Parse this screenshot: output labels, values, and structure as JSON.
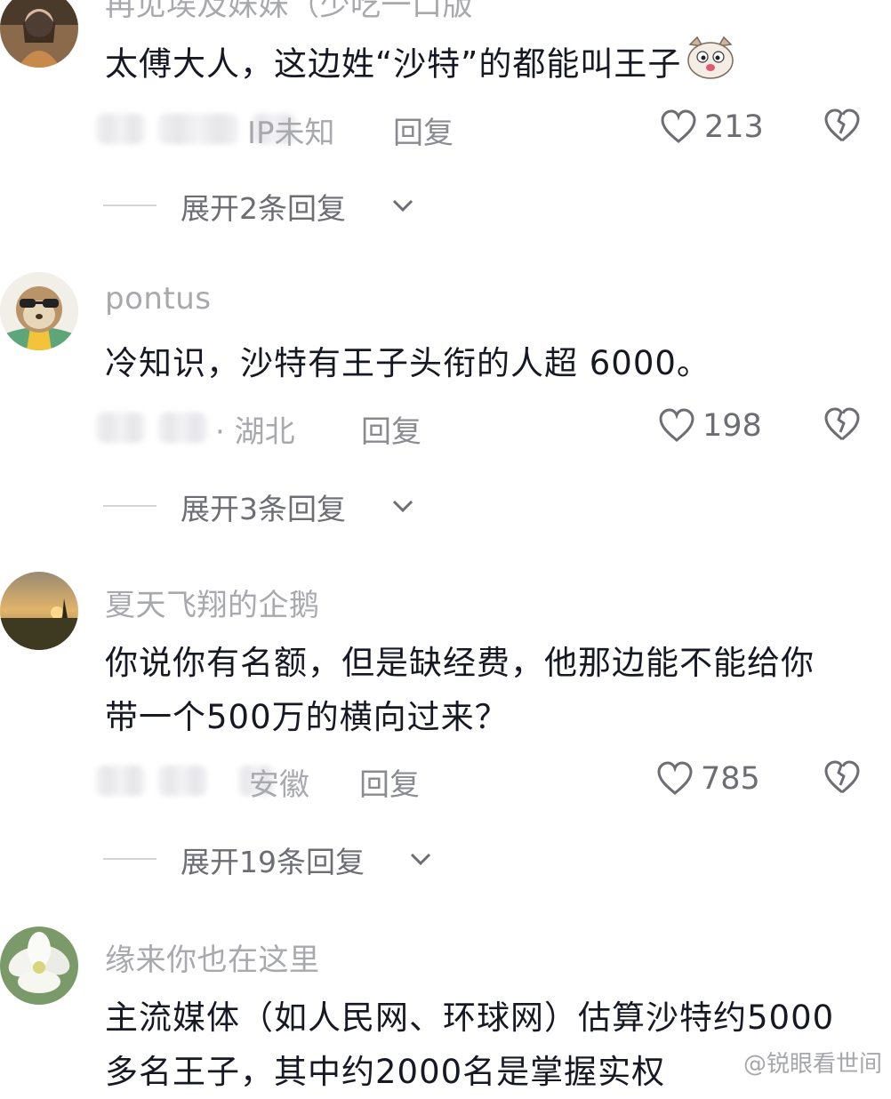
{
  "comments": [
    {
      "username": "再见埃及妹妹（少吃一口版",
      "text": "太傅大人，这边姓“沙特”的都能叫王子",
      "location": "IP未知",
      "reply_label": "回复",
      "likes": "213",
      "expand_label": "展开2条回复",
      "avatar_icon": "woman-portrait",
      "text_emoji_icon": "cat-emoji-icon"
    },
    {
      "username": "pontus",
      "text": "冷知识，沙特有王子头衔的人超 6000。",
      "location": "· 湖北",
      "reply_label": "回复",
      "likes": "198",
      "expand_label": "展开3条回复",
      "avatar_icon": "sloth-cartoon"
    },
    {
      "username": "夏天飞翔的企鹅",
      "text": "你说你有名额，但是缺经费，他那边能不能给你带一个500万的横向过来？",
      "location": "安徽",
      "reply_label": "回复",
      "likes": "785",
      "expand_label": "展开19条回复",
      "avatar_icon": "sunset-landscape"
    },
    {
      "username": "缘来你也在这里",
      "text": "主流媒体（如人民网、环球网）估算沙特约5000多名王子，其中约2000名是掌握实权",
      "avatar_icon": "white-flower"
    }
  ],
  "watermark": "@锐眼看世间",
  "colors": {
    "text": "#161823",
    "secondary": "#a8a9ad",
    "icon": "#6d6e74"
  }
}
